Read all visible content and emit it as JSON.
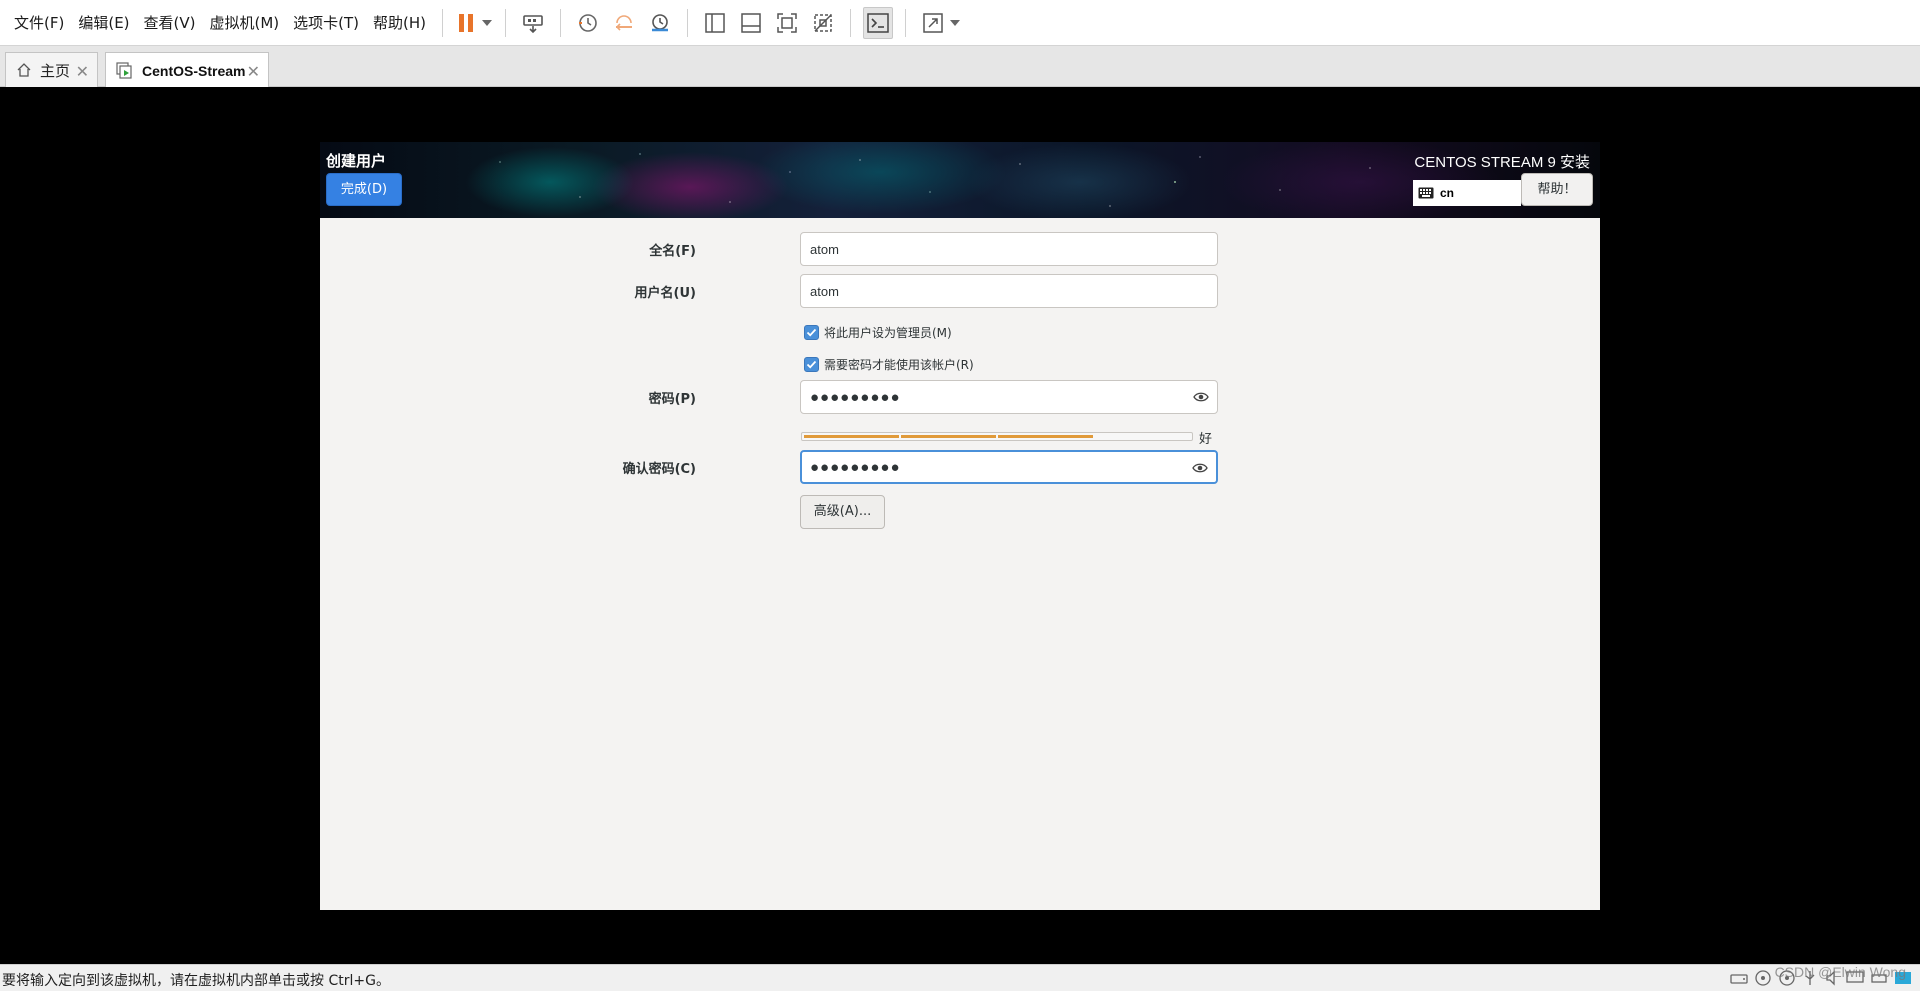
{
  "menu": {
    "file": "文件(F)",
    "edit": "编辑(E)",
    "view": "查看(V)",
    "vm": "虚拟机(M)",
    "tabs": "选项卡(T)",
    "help": "帮助(H)"
  },
  "toolbar": {
    "icons": [
      "pause-icon",
      "send-ctrl-alt-del-icon",
      "snapshot-icon",
      "revert-snapshot-icon",
      "manage-snapshots-icon",
      "show-library-icon",
      "show-thumbnail-icon",
      "full-screen-icon",
      "unity-icon",
      "console-view-icon",
      "stretch-guest-icon"
    ],
    "accent_color": "#e8742a"
  },
  "tabs": [
    {
      "label": "主页",
      "icon": "home-icon",
      "active": false
    },
    {
      "label": "CentOS-Stream",
      "icon": "vm-icon",
      "active": true
    }
  ],
  "installer": {
    "spoke_title": "创建用户",
    "done_label": "完成(D)",
    "product_title": "CENTOS STREAM 9 安装",
    "keyboard_layout": "cn",
    "help_label": "帮助！",
    "accent_color": "#3581e3"
  },
  "form": {
    "fullname_label": "全名(F)",
    "fullname_value": "atom",
    "username_label": "用户名(U)",
    "username_value": "atom",
    "admin_checkbox_label": "将此用户设为管理员(M)",
    "admin_checked": true,
    "require_password_label": "需要密码才能使用该帐户(R)",
    "require_password_checked": true,
    "password_label": "密码(P)",
    "password_value": "●●●●●●●●●",
    "strength_text": "好",
    "strength_level": 0.75,
    "confirm_label": "确认密码(C)",
    "confirm_value": "●●●●●●●●●",
    "advanced_label": "高级(A)..."
  },
  "status": {
    "hint": "要将输入定向到该虚拟机，请在虚拟机内部单击或按 Ctrl+G。",
    "watermark": "CSDN @Elwin Wong"
  }
}
